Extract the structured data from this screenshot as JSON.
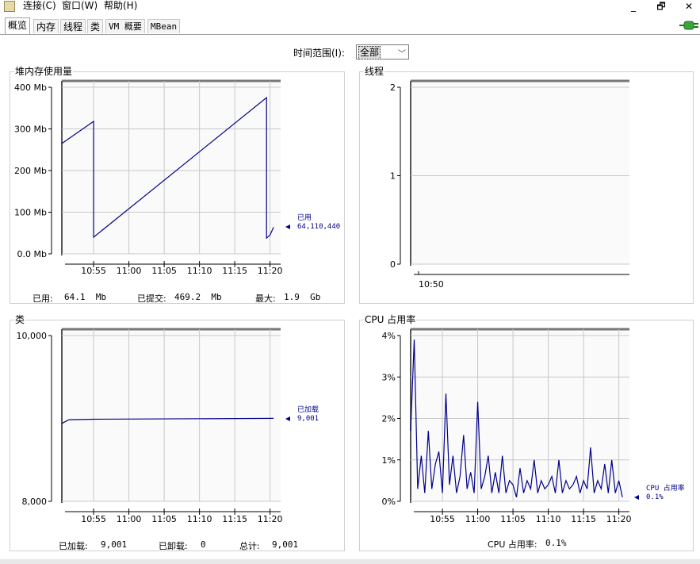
{
  "menubar": {
    "items": [
      "连接(C)",
      "窗口(W)",
      "帮助(H)"
    ],
    "window_buttons": [
      "_",
      "🗗",
      "✕"
    ]
  },
  "tabs": [
    "概览",
    "内存",
    "线程",
    "类",
    "VM 概要",
    "MBean"
  ],
  "time_range": {
    "label": "时间范围(I):",
    "value": "全部"
  },
  "panels": {
    "heap": {
      "title": "堆内存使用量",
      "stats": {
        "used_label": "已用:",
        "used": "64.1  Mb",
        "committed_label": "已提交:",
        "committed": "469.2  Mb",
        "max_label": "最大:",
        "max": "1.9  Gb"
      },
      "annotation": {
        "label": "已用",
        "value": "64,110,440"
      }
    },
    "threads": {
      "title": "线程"
    },
    "classes": {
      "title": "类",
      "stats": {
        "loaded_label": "已加载:",
        "loaded": "9,001",
        "unloaded_label": "已卸载:",
        "unloaded": "0",
        "total_label": "总计:",
        "total": "9,001"
      },
      "annotation": {
        "label": "已加载",
        "value": "9,001"
      }
    },
    "cpu": {
      "title": "CPU 占用率",
      "stats": {
        "label": "CPU 占用率:",
        "value": "0.1%"
      },
      "annotation": {
        "label": "CPU 占用率",
        "value": "0.1%"
      }
    }
  },
  "chart_data": [
    {
      "type": "line",
      "title": "堆内存使用量",
      "yticks": [
        "400 Mb",
        "300 Mb",
        "200 Mb",
        "100 Mb",
        "0.0 Mb"
      ],
      "ylim": [
        0,
        400
      ],
      "xticks": [
        "10:55",
        "11:00",
        "11:05",
        "11:10",
        "11:15",
        "11:20"
      ],
      "xlim": [
        "10:50:30",
        "11:21:30"
      ],
      "grid": true,
      "series": [
        {
          "name": "已用",
          "color": "#00008b",
          "x": [
            "10:50:30",
            "10:55:00",
            "10:55:00",
            "11:19:30",
            "11:19:30",
            "11:20:00",
            "11:20:30"
          ],
          "y": [
            265,
            318,
            40,
            375,
            38,
            45,
            64
          ]
        }
      ]
    },
    {
      "type": "line",
      "title": "线程",
      "yticks": [
        "2",
        "1",
        "0"
      ],
      "ylim": [
        0,
        2
      ],
      "xticks": [
        "10:50"
      ],
      "grid": true,
      "series": []
    },
    {
      "type": "line",
      "title": "类",
      "yticks": [
        "10,000",
        "8,000"
      ],
      "ylim": [
        8000,
        10000
      ],
      "xticks": [
        "10:55",
        "11:00",
        "11:05",
        "11:10",
        "11:15",
        "11:20"
      ],
      "xlim": [
        "10:50:30",
        "11:21:30"
      ],
      "grid": true,
      "series": [
        {
          "name": "已加载",
          "color": "#00008b",
          "x": [
            "10:50:30",
            "10:51:30",
            "10:55:00",
            "11:20:30"
          ],
          "y": [
            8940,
            8985,
            8990,
            9001
          ]
        }
      ]
    },
    {
      "type": "line",
      "title": "CPU 占用率",
      "yticks": [
        "4%",
        "3%",
        "2%",
        "1%",
        "0%"
      ],
      "ylim": [
        0,
        4
      ],
      "xticks": [
        "10:55",
        "11:00",
        "11:05",
        "11:10",
        "11:15",
        "11:20"
      ],
      "xlim": [
        "10:50:30",
        "11:21:30"
      ],
      "grid": true,
      "series": [
        {
          "name": "CPU 占用率",
          "color": "#00008b",
          "x": [
            "10:50:30",
            "10:51:00",
            "10:51:30",
            "10:52:00",
            "10:52:30",
            "10:53:00",
            "10:53:30",
            "10:54:00",
            "10:54:30",
            "10:55:00",
            "10:55:30",
            "10:56:00",
            "10:56:30",
            "10:57:00",
            "10:57:30",
            "10:58:00",
            "10:58:30",
            "10:59:00",
            "10:59:30",
            "11:00:00",
            "11:00:30",
            "11:01:00",
            "11:01:30",
            "11:02:00",
            "11:02:30",
            "11:03:00",
            "11:03:30",
            "11:04:00",
            "11:04:30",
            "11:05:00",
            "11:05:30",
            "11:06:00",
            "11:06:30",
            "11:07:00",
            "11:07:30",
            "11:08:00",
            "11:08:30",
            "11:09:00",
            "11:09:30",
            "11:10:00",
            "11:10:30",
            "11:11:00",
            "11:11:30",
            "11:12:00",
            "11:12:30",
            "11:13:00",
            "11:13:30",
            "11:14:00",
            "11:14:30",
            "11:15:00",
            "11:15:30",
            "11:16:00",
            "11:16:30",
            "11:17:00",
            "11:17:30",
            "11:18:00",
            "11:18:30",
            "11:19:00",
            "11:19:30",
            "11:20:00",
            "11:20:30"
          ],
          "y": [
            1.7,
            3.9,
            0.3,
            1.1,
            0.2,
            1.7,
            0.3,
            0.9,
            1.2,
            0.2,
            2.6,
            0.4,
            1.1,
            0.2,
            0.6,
            1.6,
            0.3,
            0.7,
            0.2,
            2.4,
            0.3,
            0.6,
            1.1,
            0.2,
            0.7,
            0.2,
            1.1,
            0.2,
            0.5,
            0.4,
            0.1,
            0.8,
            0.2,
            0.5,
            0.3,
            1.0,
            0.2,
            0.5,
            0.3,
            0.4,
            0.6,
            0.2,
            1.0,
            0.2,
            0.5,
            0.3,
            0.4,
            0.6,
            0.2,
            0.5,
            0.3,
            1.3,
            0.2,
            0.5,
            0.3,
            0.9,
            0.2,
            1.0,
            0.2,
            0.5,
            0.1
          ]
        }
      ]
    }
  ]
}
